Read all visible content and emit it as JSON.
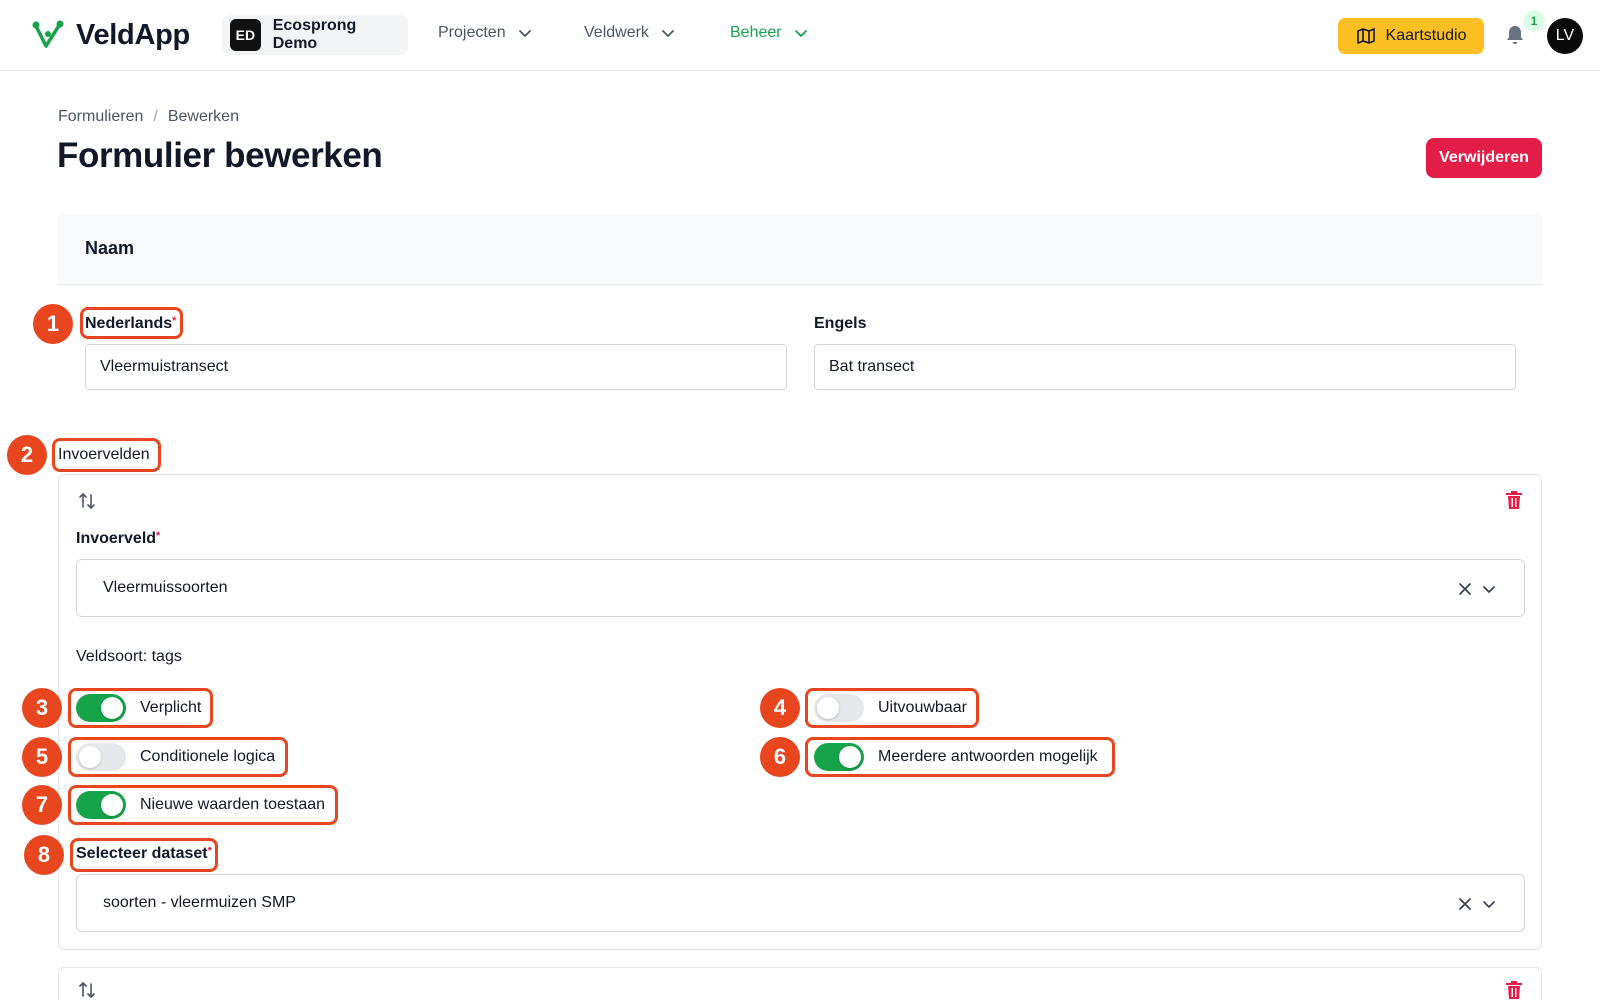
{
  "app": {
    "name": "VeldApp",
    "org_initials": "ED",
    "org_name": "Ecosprong Demo"
  },
  "nav": {
    "items": [
      {
        "label": "Projecten"
      },
      {
        "label": "Veldwerk"
      },
      {
        "label": "Beheer",
        "active": true
      }
    ],
    "kaartstudio_label": "Kaartstudio",
    "notification_count": "1",
    "avatar_initials": "LV"
  },
  "colors": {
    "brand_green": "#16a34a",
    "accent_yellow": "#fbbf24",
    "danger_red": "#e11d48",
    "annotation_orange": "#e8461e"
  },
  "breadcrumb": [
    "Formulieren",
    "Bewerken"
  ],
  "page": {
    "title": "Formulier bewerken",
    "delete_label": "Verwijderen"
  },
  "naam": {
    "section_title": "Naam",
    "nl_label": "Nederlands",
    "nl_value": "Vleermuistransect",
    "en_label": "Engels",
    "en_value": "Bat transect"
  },
  "invoervelden": {
    "section_label": "Invoervelden",
    "field_label": "Invoerveld",
    "field_value": "Vleermuissoorten",
    "veldsoort": "Veldsoort: tags",
    "toggles": {
      "verplicht": {
        "label": "Verplicht",
        "on": true
      },
      "uitvouwbaar": {
        "label": "Uitvouwbaar",
        "on": false
      },
      "conditionele_logica": {
        "label": "Conditionele logica",
        "on": false
      },
      "meerdere_antwoorden": {
        "label": "Meerdere antwoorden mogelijk",
        "on": true
      },
      "nieuwe_waarden": {
        "label": "Nieuwe waarden toestaan",
        "on": true
      }
    },
    "dataset_label": "Selecteer dataset",
    "dataset_value": "soorten - vleermuizen SMP"
  },
  "annotations": [
    "1",
    "2",
    "3",
    "4",
    "5",
    "6",
    "7",
    "8"
  ]
}
